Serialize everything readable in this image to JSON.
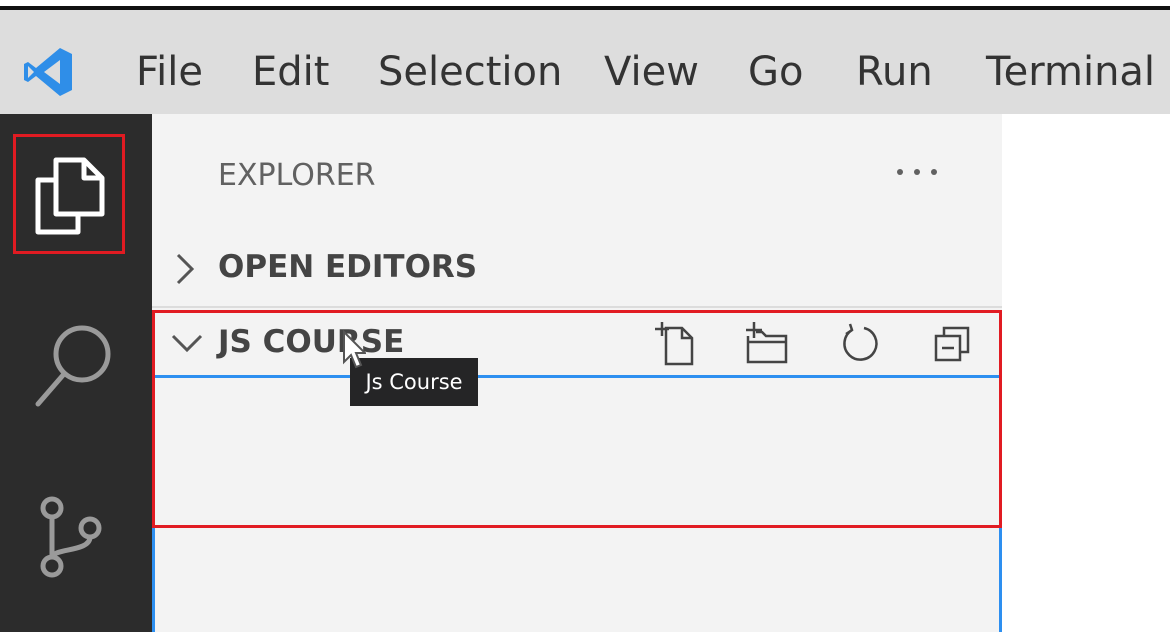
{
  "menu": {
    "items": [
      "File",
      "Edit",
      "Selection",
      "View",
      "Go",
      "Run",
      "Terminal"
    ]
  },
  "activity_bar": {
    "icons": [
      "explorer-icon",
      "search-icon",
      "source-control-icon"
    ]
  },
  "explorer": {
    "title": "EXPLORER",
    "more_label": "···",
    "sections": [
      {
        "label": "OPEN EDITORS",
        "expanded": false
      },
      {
        "label": "JS COURSE",
        "expanded": true
      }
    ],
    "toolbar_icons": [
      "new-file-icon",
      "new-folder-icon",
      "refresh-icon",
      "collapse-all-icon"
    ],
    "tooltip": "Js Course"
  },
  "colors": {
    "highlight": "#e11b22",
    "focus": "#2d8ff0",
    "vscode_blue": "#2f8ee8",
    "activity_bg": "#2c2c2c"
  }
}
